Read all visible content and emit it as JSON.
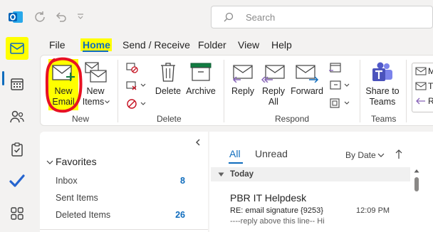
{
  "search": {
    "placeholder": "Search"
  },
  "menu": {
    "tabs": [
      "File",
      "Home",
      "Send / Receive",
      "Folder",
      "View",
      "Help"
    ],
    "active": "Home"
  },
  "ribbon": {
    "new_email": {
      "line1": "New",
      "line2": "Email"
    },
    "new_items": {
      "line1": "New",
      "line2": "Items"
    },
    "delete": "Delete",
    "archive": "Archive",
    "reply": "Reply",
    "reply_all": {
      "line1": "Reply",
      "line2": "All"
    },
    "forward": "Forward",
    "share_to_teams": {
      "line1": "Share to",
      "line2": "Teams"
    },
    "groups": {
      "new": "New",
      "delete": "Delete",
      "respond": "Respond",
      "teams": "Teams"
    },
    "partial_items": [
      "M",
      "T",
      "R"
    ]
  },
  "folders": {
    "favorites_label": "Favorites",
    "items": [
      {
        "label": "Inbox",
        "count": "8"
      },
      {
        "label": "Sent Items",
        "count": ""
      },
      {
        "label": "Deleted Items",
        "count": "26"
      }
    ]
  },
  "message_list": {
    "filter_all": "All",
    "filter_unread": "Unread",
    "sort_label": "By Date",
    "group_header": "Today",
    "messages": [
      {
        "sender": "PBR IT Helpdesk",
        "subject": "RE: email signature {9253}",
        "time": "12:09 PM",
        "preview": "----reply above this line--  Hi"
      }
    ]
  },
  "colors": {
    "accent": "#0f6cbd",
    "highlight": "#ffff00",
    "annotation": "#e81123"
  }
}
